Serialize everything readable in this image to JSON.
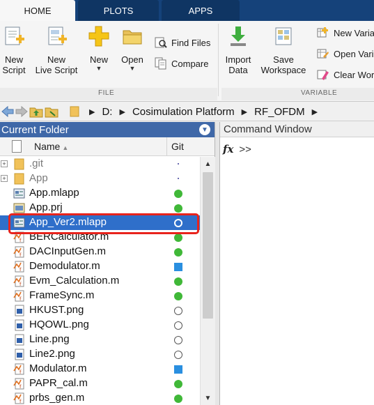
{
  "tabs": [
    {
      "label": "HOME",
      "active": true
    },
    {
      "label": "PLOTS",
      "active": false
    },
    {
      "label": "APPS",
      "active": false
    }
  ],
  "ribbon": {
    "file": {
      "group_label": "FILE",
      "new_script": [
        "New",
        "Script"
      ],
      "new_live_script": [
        "New",
        "Live Script"
      ],
      "new": "New",
      "open": "Open",
      "find_files": "Find Files",
      "compare": "Compare"
    },
    "variable": {
      "group_label": "VARIABLE",
      "import_data": [
        "Import",
        "Data"
      ],
      "save_workspace": [
        "Save",
        "Workspace"
      ],
      "new_variable": "New Varia",
      "open_variable": "Open Vari",
      "clear_workspace": "Clear Wor"
    }
  },
  "address": {
    "crumbs": [
      "D:",
      "Cosimulation Platform",
      "RF_OFDM"
    ]
  },
  "current_folder": {
    "title": "Current Folder",
    "col_name": "Name",
    "col_git": "Git",
    "files": [
      {
        "name": ".git",
        "type": "folder",
        "git": "dot",
        "expandable": true,
        "dim": true
      },
      {
        "name": "App",
        "type": "folder",
        "git": "dot",
        "expandable": true,
        "dim": true
      },
      {
        "name": "App.mlapp",
        "type": "mlapp",
        "git": "green"
      },
      {
        "name": "App.prj",
        "type": "prj",
        "git": "green"
      },
      {
        "name": "App_Ver2.mlapp",
        "type": "mlapp",
        "git": "selc",
        "selected": true
      },
      {
        "name": "BERCalculator.m",
        "type": "m",
        "git": "green"
      },
      {
        "name": "DACInputGen.m",
        "type": "m",
        "git": "green"
      },
      {
        "name": "Demodulator.m",
        "type": "m",
        "git": "blue"
      },
      {
        "name": "Evm_Calculation.m",
        "type": "m",
        "git": "green"
      },
      {
        "name": "FrameSync.m",
        "type": "m",
        "git": "green"
      },
      {
        "name": "HKUST.png",
        "type": "png",
        "git": "empty"
      },
      {
        "name": "HQOWL.png",
        "type": "png",
        "git": "empty"
      },
      {
        "name": "Line.png",
        "type": "png",
        "git": "empty"
      },
      {
        "name": "Line2.png",
        "type": "png",
        "git": "empty"
      },
      {
        "name": "Modulator.m",
        "type": "m",
        "git": "blue"
      },
      {
        "name": "PAPR_cal.m",
        "type": "m",
        "git": "green"
      },
      {
        "name": "prbs_gen.m",
        "type": "m",
        "git": "green"
      }
    ]
  },
  "command_window": {
    "title": "Command Window",
    "prompt": ">>"
  }
}
